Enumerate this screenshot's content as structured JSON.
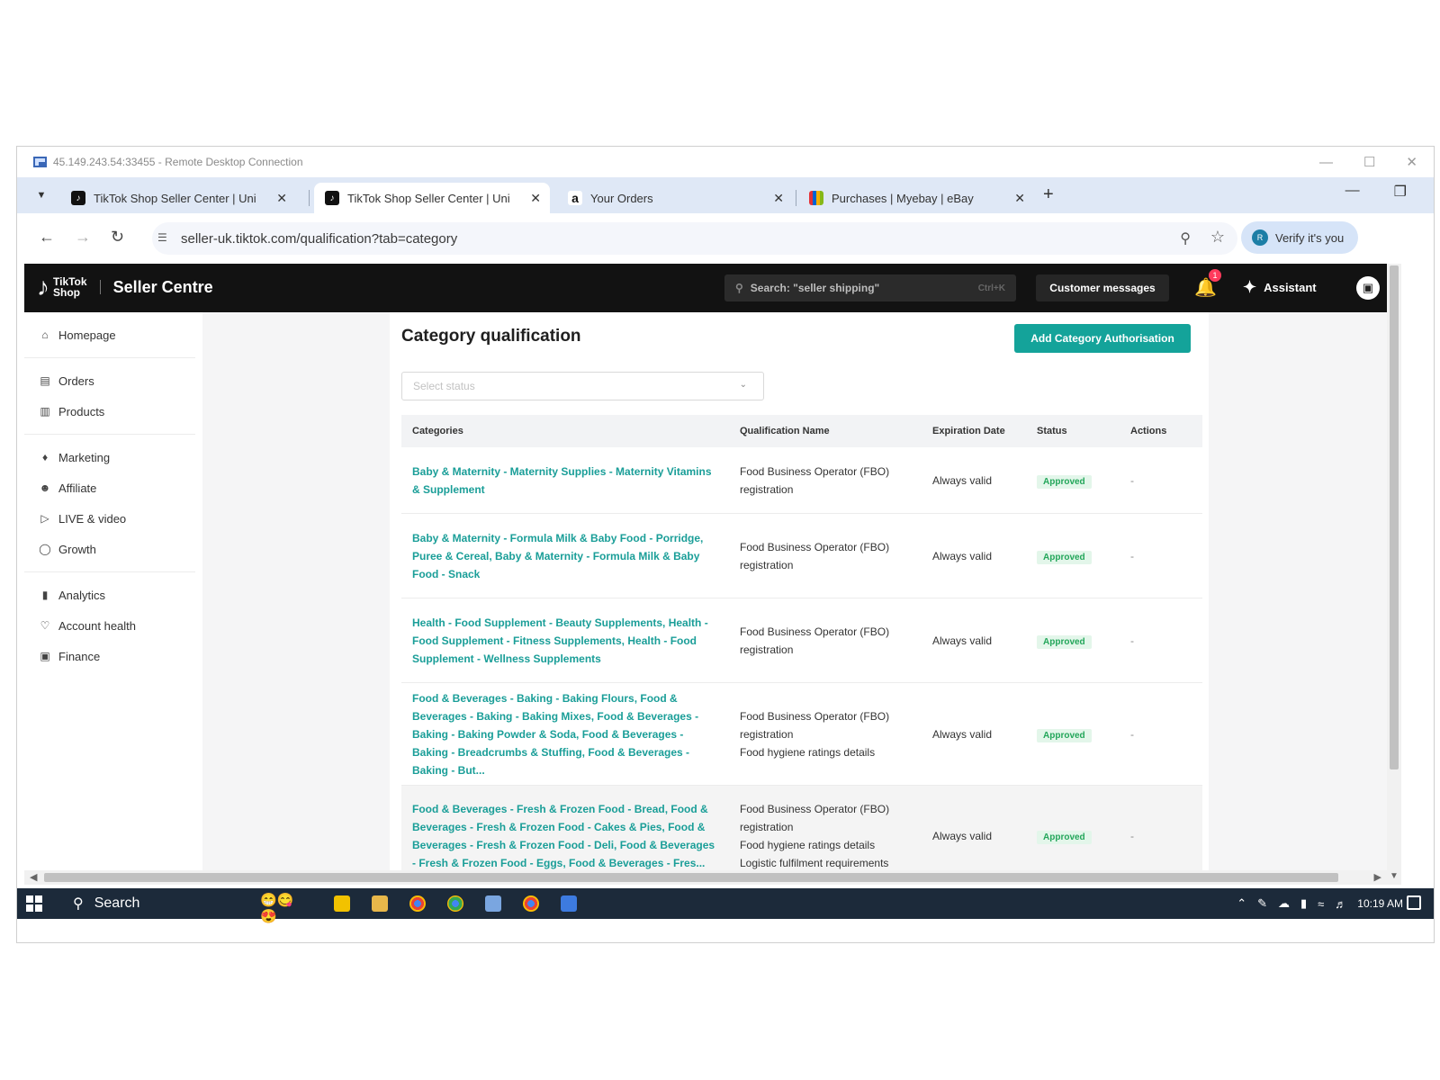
{
  "rdp": {
    "title": "45.149.243.54:33455 - Remote Desktop Connection",
    "minimize": "—",
    "maximize": "☐",
    "close": "✕"
  },
  "browser": {
    "tabs": [
      {
        "title": "TikTok Shop Seller Center | Uni",
        "icon": "tiktok-icon",
        "active": false
      },
      {
        "title": "TikTok Shop Seller Center | Uni",
        "icon": "tiktok-icon",
        "active": true
      },
      {
        "title": "Your Orders",
        "icon": "amazon-icon",
        "active": false
      },
      {
        "title": "Purchases | Myebay | eBay",
        "icon": "ebay-icon",
        "active": false
      }
    ],
    "new_tab": "+",
    "url": "seller-uk.tiktok.com/qualification?tab=category",
    "verify_label": "Verify it's you"
  },
  "header": {
    "logo_top": "TikTok",
    "logo_bottom": "Shop",
    "product_name": "Seller Centre",
    "search_placeholder": "Search: \"seller shipping\"",
    "search_shortcut": "Ctrl+K",
    "customer_messages": "Customer messages",
    "notification_count": "1",
    "assistant_label": "Assistant"
  },
  "sidebar": {
    "groups": [
      [
        {
          "label": "Homepage",
          "icon": "home-icon"
        }
      ],
      [
        {
          "label": "Orders",
          "icon": "orders-icon"
        },
        {
          "label": "Products",
          "icon": "products-icon"
        }
      ],
      [
        {
          "label": "Marketing",
          "icon": "megaphone-icon"
        },
        {
          "label": "Affiliate",
          "icon": "affiliate-icon"
        },
        {
          "label": "LIVE & video",
          "icon": "live-video-icon"
        },
        {
          "label": "Growth",
          "icon": "growth-icon"
        }
      ],
      [
        {
          "label": "Analytics",
          "icon": "analytics-icon"
        },
        {
          "label": "Account health",
          "icon": "account-health-icon"
        },
        {
          "label": "Finance",
          "icon": "finance-icon"
        }
      ]
    ]
  },
  "main": {
    "title": "Category qualification",
    "add_button": "Add Category Authorisation",
    "status_placeholder": "Select status",
    "columns": [
      "Categories",
      "Qualification Name",
      "Expiration Date",
      "Status",
      "Actions"
    ],
    "rows": [
      {
        "category": "Baby & Maternity - Maternity Supplies - Maternity Vitamins & Supplement",
        "qualification": [
          "Food Business Operator (FBO) registration"
        ],
        "expiration": "Always valid",
        "status": "Approved",
        "action": "-"
      },
      {
        "category": "Baby & Maternity - Formula Milk & Baby Food - Porridge, Puree & Cereal, Baby & Maternity - Formula Milk & Baby Food - Snack",
        "qualification": [
          "Food Business Operator (FBO) registration"
        ],
        "expiration": "Always valid",
        "status": "Approved",
        "action": "-"
      },
      {
        "category": "Health - Food Supplement - Beauty Supplements, Health - Food Supplement - Fitness Supplements, Health - Food Supplement - Wellness Supplements",
        "qualification": [
          "Food Business Operator (FBO) registration"
        ],
        "expiration": "Always valid",
        "status": "Approved",
        "action": "-"
      },
      {
        "category": "Food & Beverages - Baking - Baking Flours, Food & Beverages - Baking - Baking Mixes, Food & Beverages - Baking - Baking Powder & Soda, Food & Beverages - Baking - Breadcrumbs & Stuffing, Food & Beverages - Baking - But...",
        "qualification": [
          "Food Business Operator (FBO) registration",
          "Food hygiene ratings details"
        ],
        "expiration": "Always valid",
        "status": "Approved",
        "action": "-"
      },
      {
        "category": "Food & Beverages - Fresh & Frozen Food - Bread, Food & Beverages - Fresh & Frozen Food - Cakes & Pies, Food & Beverages - Fresh & Frozen Food - Deli, Food & Beverages - Fresh & Frozen Food - Eggs, Food & Beverages - Fres...",
        "qualification": [
          "Food Business Operator (FBO) registration",
          "Food hygiene ratings details",
          "Logistic fulfilment requirements"
        ],
        "expiration": "Always valid",
        "status": "Approved",
        "action": "-"
      }
    ]
  },
  "taskbar": {
    "search_label": "Search",
    "time": "10:19 AM"
  }
}
